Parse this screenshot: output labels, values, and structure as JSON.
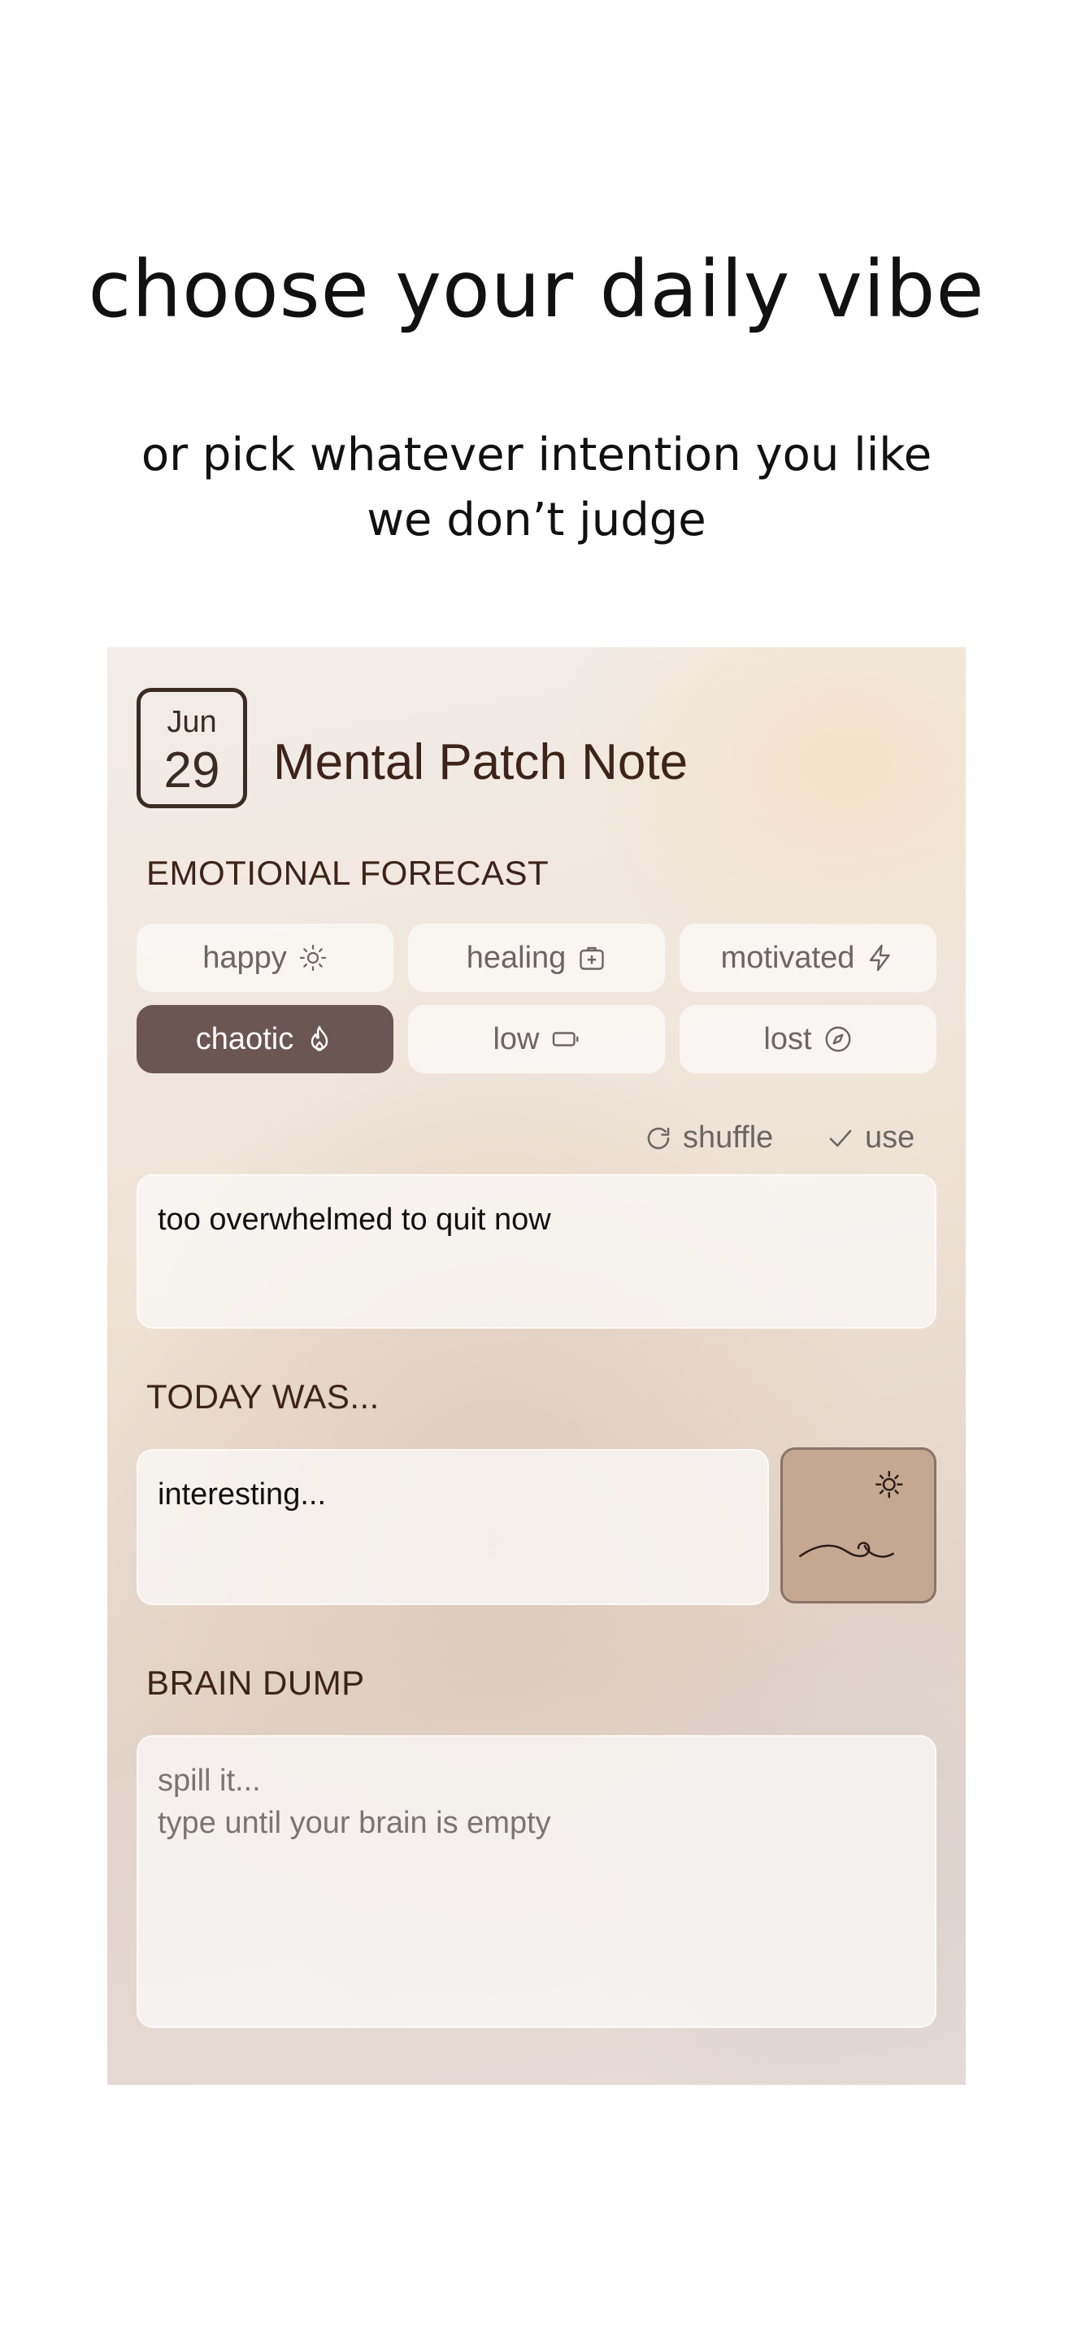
{
  "hero": {
    "title": "choose your daily vibe",
    "subtitle_line1": "or pick whatever intention you like",
    "subtitle_line2": "we don’t judge"
  },
  "note": {
    "month": "Jun",
    "day": "29",
    "title": "Mental Patch Note"
  },
  "forecast": {
    "label": "EMOTIONAL FORECAST",
    "moods": [
      {
        "label": "happy",
        "icon": "sun-icon",
        "selected": false
      },
      {
        "label": "healing",
        "icon": "first-aid-icon",
        "selected": false
      },
      {
        "label": "motivated",
        "icon": "lightning-icon",
        "selected": false
      },
      {
        "label": "chaotic",
        "icon": "flame-icon",
        "selected": true
      },
      {
        "label": "low",
        "icon": "battery-low-icon",
        "selected": false
      },
      {
        "label": "lost",
        "icon": "compass-icon",
        "selected": false
      }
    ],
    "shuffle_label": "shuffle",
    "use_label": "use",
    "intention_text": "too overwhelmed to quit now"
  },
  "today": {
    "label": "TODAY WAS...",
    "value": "interesting...",
    "sticker_icon": "wave-sun-icon"
  },
  "brain_dump": {
    "label": "BRAIN DUMP",
    "placeholder_line1": "spill it...",
    "placeholder_line2": "type until your brain is empty"
  },
  "colors": {
    "selected_chip": "#6b5654",
    "heading_brown": "#3e2319",
    "sticker_bg": "#c6a891"
  }
}
